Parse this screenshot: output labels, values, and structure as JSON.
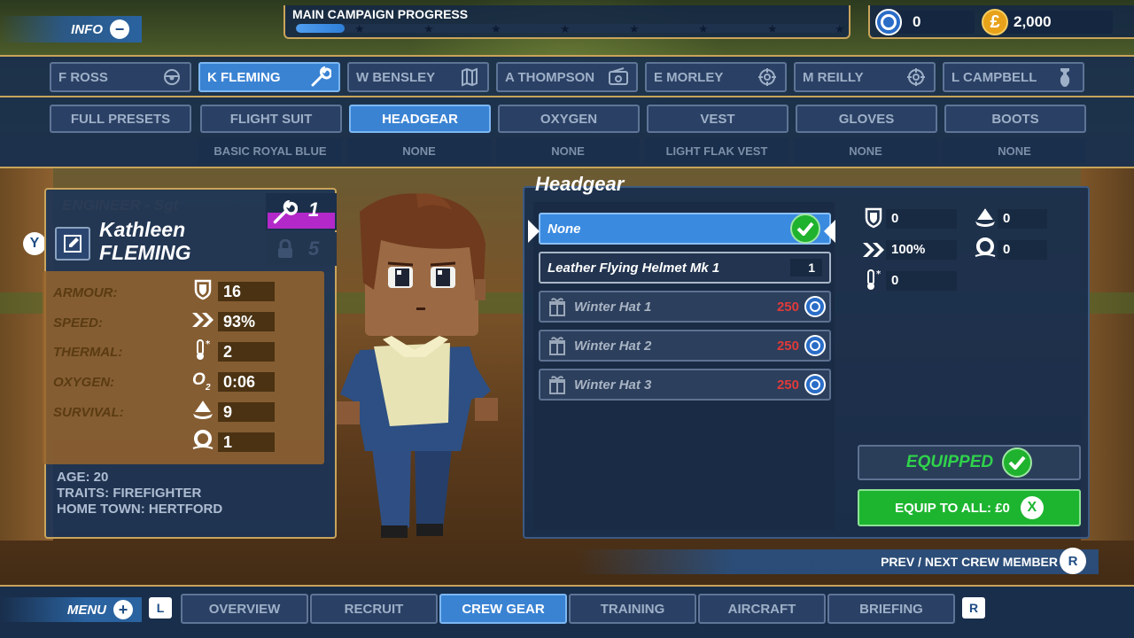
{
  "top": {
    "info_label": "INFO",
    "info_symbol": "−",
    "campaign_title": "MAIN CAMPAIGN PROGRESS",
    "campaign_progress": 0.09,
    "coins": "0",
    "money": "2,000"
  },
  "crew": [
    {
      "label": "F ROSS",
      "icon": "steering-wheel-icon",
      "active": false
    },
    {
      "label": "K FLEMING",
      "icon": "wrench-icon",
      "active": true
    },
    {
      "label": "W BENSLEY",
      "icon": "map-icon",
      "active": false
    },
    {
      "label": "A THOMPSON",
      "icon": "radio-icon",
      "active": false
    },
    {
      "label": "E MORLEY",
      "icon": "crosshair-icon",
      "active": false
    },
    {
      "label": "M REILLY",
      "icon": "crosshair-icon",
      "active": false
    },
    {
      "label": "L CAMPBELL",
      "icon": "bomb-icon",
      "active": false
    }
  ],
  "categories": [
    {
      "label": "FULL PRESETS",
      "value": "",
      "active": false
    },
    {
      "label": "FLIGHT SUIT",
      "value": "BASIC ROYAL BLUE",
      "active": false
    },
    {
      "label": "HEADGEAR",
      "value": "NONE",
      "active": true
    },
    {
      "label": "OXYGEN",
      "value": "NONE",
      "active": false
    },
    {
      "label": "VEST",
      "value": "LIGHT FLAK VEST",
      "active": false
    },
    {
      "label": "GLOVES",
      "value": "NONE",
      "active": false
    },
    {
      "label": "BOOTS",
      "value": "NONE",
      "active": false
    }
  ],
  "character": {
    "role": "ENGINEER - Sgt",
    "first_name": "Kathleen",
    "last_name": "FLEMING",
    "y_button": "Y",
    "skill_level": "1",
    "locked_level": "5",
    "stats": {
      "armour_label": "ARMOUR:",
      "armour": "16",
      "speed_label": "SPEED:",
      "speed": "93%",
      "thermal_label": "THERMAL:",
      "thermal": "2",
      "oxygen_label": "OXYGEN:",
      "oxygen": "0:06",
      "survival_label": "SURVIVAL:",
      "survival_1": "9",
      "survival_2": "1"
    },
    "age": "AGE: 20",
    "traits": "TRAITS: FIREFIGHTER",
    "home_town": "HOME TOWN: HERTFORD"
  },
  "headgear": {
    "title": "Headgear",
    "items": [
      {
        "name": "None",
        "state": "selected"
      },
      {
        "name": "Leather Flying Helmet Mk 1",
        "qty": "1",
        "state": "owned"
      },
      {
        "name": "Winter Hat 1",
        "price": "250",
        "state": "locked"
      },
      {
        "name": "Winter Hat 2",
        "price": "250",
        "state": "locked"
      },
      {
        "name": "Winter Hat 3",
        "price": "250",
        "state": "locked"
      }
    ],
    "mod_armour": "0",
    "mod_speed": "100%",
    "mod_thermal": "0",
    "mod_survival_1": "0",
    "mod_survival_2": "0",
    "equipped_label": "EQUIPPED",
    "equip_all_label": "EQUIP TO ALL: £0",
    "equip_all_button": "X"
  },
  "prev_next": "PREV / NEXT CREW MEMBER",
  "prev_next_button": "R",
  "bottom": {
    "menu_label": "MENU",
    "menu_symbol": "+",
    "left_shoulder": "L",
    "right_shoulder": "R",
    "tabs": [
      {
        "label": "OVERVIEW",
        "active": false
      },
      {
        "label": "RECRUIT",
        "active": false
      },
      {
        "label": "CREW GEAR",
        "active": true
      },
      {
        "label": "TRAINING",
        "active": false
      },
      {
        "label": "AIRCRAFT",
        "active": false
      },
      {
        "label": "BRIEFING",
        "active": false
      }
    ]
  },
  "colors": {
    "accent_blue": "#3a83d3",
    "panel": "#172e4e",
    "gold_border": "#c9a45b",
    "green": "#1db530",
    "price_red": "#e03a3a",
    "skill_purple": "#b328c9"
  }
}
